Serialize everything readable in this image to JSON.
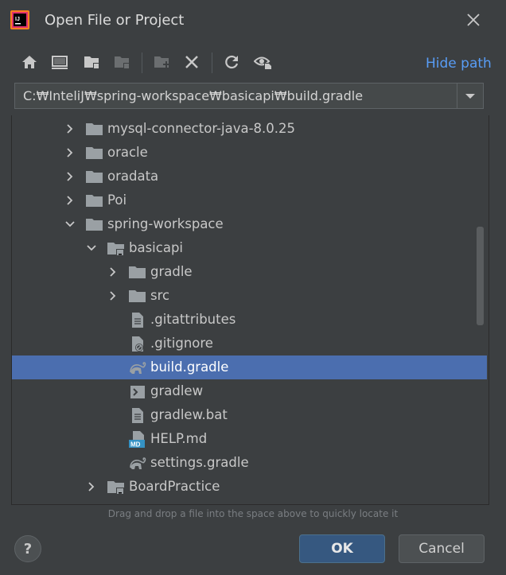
{
  "dialog": {
    "title": "Open File or Project"
  },
  "toolbar": {
    "icons": [
      "home-icon",
      "desktop-icon",
      "project-folder-icon",
      "module-folder-icon",
      "new-folder-icon",
      "delete-icon",
      "refresh-icon",
      "show-hidden-icon"
    ],
    "hide_path_label": "Hide path"
  },
  "path": {
    "value": "C:₩InteliJ₩spring-workspace₩basicapi₩build.gradle"
  },
  "tree": {
    "items": [
      {
        "label": "mysql-connector-java-8.0.25",
        "depth": 0,
        "type": "folder",
        "expanded": false
      },
      {
        "label": "oracle",
        "depth": 0,
        "type": "folder",
        "expanded": false
      },
      {
        "label": "oradata",
        "depth": 0,
        "type": "folder",
        "expanded": false
      },
      {
        "label": "Poi",
        "depth": 0,
        "type": "folder",
        "expanded": false
      },
      {
        "label": "spring-workspace",
        "depth": 0,
        "type": "folder",
        "expanded": true
      },
      {
        "label": "basicapi",
        "depth": 1,
        "type": "project-folder",
        "expanded": true
      },
      {
        "label": "gradle",
        "depth": 2,
        "type": "folder",
        "expanded": false
      },
      {
        "label": "src",
        "depth": 2,
        "type": "folder",
        "expanded": false
      },
      {
        "label": ".gitattributes",
        "depth": 2,
        "type": "text-file"
      },
      {
        "label": ".gitignore",
        "depth": 2,
        "type": "ignore-file"
      },
      {
        "label": "build.gradle",
        "depth": 2,
        "type": "gradle-file",
        "selected": true
      },
      {
        "label": "gradlew",
        "depth": 2,
        "type": "shell-file"
      },
      {
        "label": "gradlew.bat",
        "depth": 2,
        "type": "text-file"
      },
      {
        "label": "HELP.md",
        "depth": 2,
        "type": "markdown-file"
      },
      {
        "label": "settings.gradle",
        "depth": 2,
        "type": "gradle-file"
      },
      {
        "label": "BoardPractice",
        "depth": 1,
        "type": "project-folder",
        "expanded": false
      }
    ]
  },
  "hint": "Drag and drop a file into the space above to quickly locate it",
  "buttons": {
    "ok": "OK",
    "cancel": "Cancel",
    "help": "?"
  },
  "colors": {
    "accent": "#4b6eaf",
    "link": "#589df6",
    "ok_bg": "#365880",
    "background": "#3c3f41"
  }
}
